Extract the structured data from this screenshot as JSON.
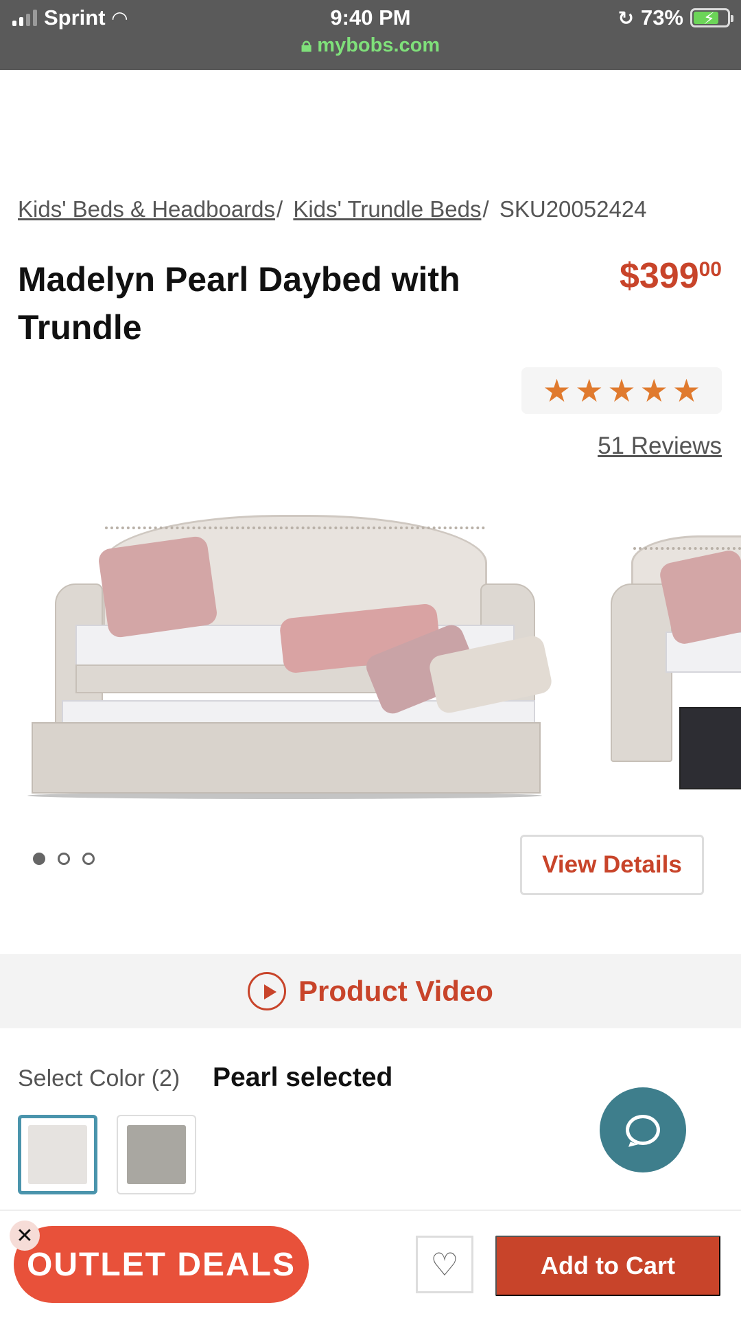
{
  "status_bar": {
    "carrier": "Sprint",
    "time": "9:40 PM",
    "battery": "73%",
    "url": "mybobs.com"
  },
  "breadcrumb": {
    "items": [
      "Kids' Beds & Headboards",
      "Kids' Trundle Beds"
    ],
    "separator": "/",
    "sku": "SKU20052424"
  },
  "product": {
    "title": "Madelyn Pearl Daybed with Trundle",
    "price_dollars": "$399",
    "price_cents": "00",
    "rating_stars": 5,
    "reviews_label": "51 Reviews"
  },
  "gallery": {
    "image_count": 3,
    "active_index": 0,
    "view_details_label": "View Details"
  },
  "video": {
    "label": "Product Video"
  },
  "colors": {
    "label": "Select Color (2)",
    "selected_label": "Pearl selected",
    "swatches": [
      {
        "name": "Pearl",
        "color": "#e6e3e0",
        "selected": true
      },
      {
        "name": "Gray",
        "color": "#a9a7a1",
        "selected": false
      }
    ]
  },
  "bottom": {
    "outlet_label": "OUTLET DEALS",
    "add_to_cart_label": "Add to Cart"
  },
  "colors_theme": {
    "accent": "#c8442a",
    "outlet": "#e8513a",
    "chat": "#3e7e8c",
    "star": "#e07a2e",
    "status_bar": "#5a5a5a",
    "url_green": "#7fe07a"
  }
}
